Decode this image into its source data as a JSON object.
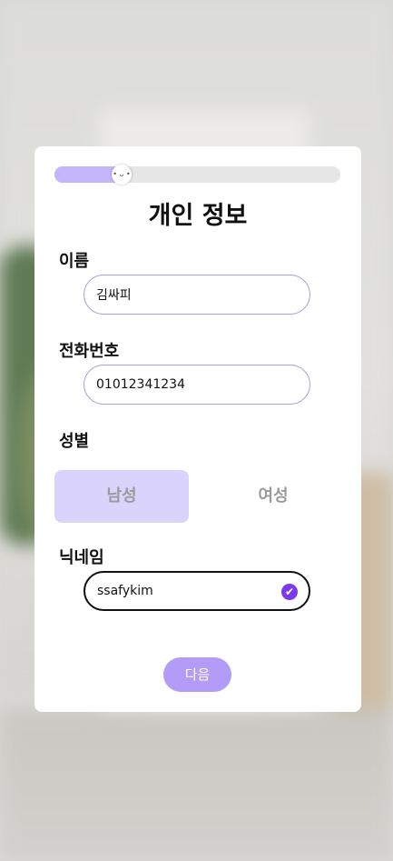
{
  "progress": {
    "value": 0.2,
    "thumb_glyph": "• ᴗ •"
  },
  "title": "개인 정보",
  "name": {
    "label": "이름",
    "value": "김싸피"
  },
  "phone": {
    "label": "전화번호",
    "value": "01012341234"
  },
  "gender": {
    "label": "성별",
    "options": [
      "남성",
      "여성"
    ],
    "selected": "남성"
  },
  "nickname": {
    "label": "닉네임",
    "value": "ssafykim",
    "valid": true
  },
  "next_button": "다음",
  "colors": {
    "accent": "#b39cf7",
    "selected_bg": "#dad4fc",
    "check": "#7c3aed",
    "progress_fill": "#c4b5fd"
  }
}
